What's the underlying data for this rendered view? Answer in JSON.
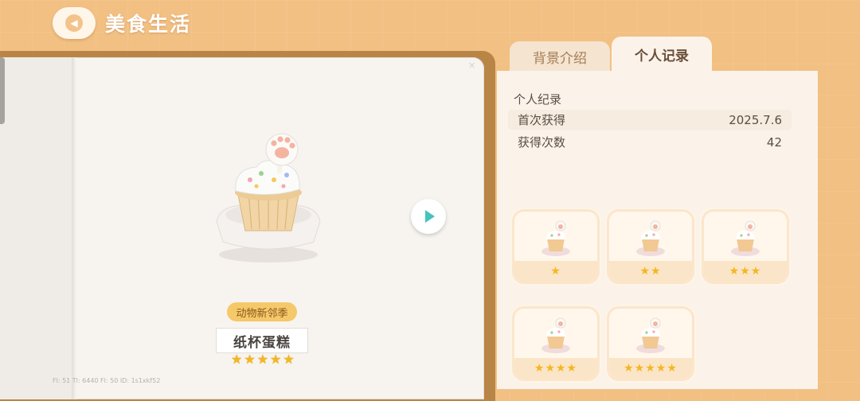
{
  "header": {
    "title": "美食生活",
    "back_icon": "chevron-left-icon"
  },
  "tabs": [
    {
      "label": "背景介绍",
      "active": false
    },
    {
      "label": "个人记录",
      "active": true
    }
  ],
  "item": {
    "season": "动物新邻季",
    "name": "纸杯蛋糕",
    "stars": "★★★★★",
    "rating": 5
  },
  "debug": "Fl: 51    Tl: 6440    Fl: 50    ID: 1s1xkf52",
  "record": {
    "title": "个人纪录",
    "rows": [
      {
        "label": "首次获得",
        "value": "2025.7.6"
      },
      {
        "label": "获得次数",
        "value": "42"
      }
    ]
  },
  "variants": [
    {
      "stars": "★",
      "rating": 1
    },
    {
      "stars": "★★",
      "rating": 2
    },
    {
      "stars": "★★★",
      "rating": 3
    },
    {
      "stars": "★★★★",
      "rating": 4
    },
    {
      "stars": "★★★★★",
      "rating": 5
    }
  ],
  "colors": {
    "background": "#f2c083",
    "star": "#f4b720",
    "accent": "#45c3be",
    "badge": "#f5c86a"
  }
}
